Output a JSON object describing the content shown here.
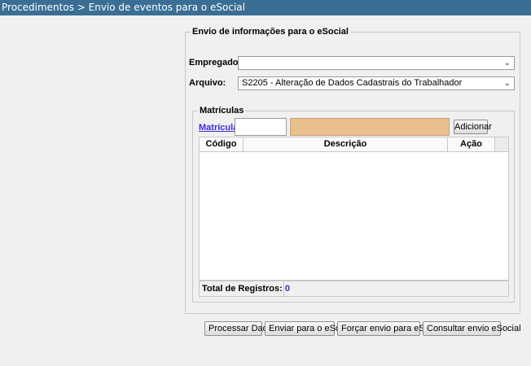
{
  "header": {
    "breadcrumb": "Procedimentos > Envio de eventos para o eSocial"
  },
  "form": {
    "legend": "Envio de informações para o eSocial",
    "empregador": {
      "label": "Empregador:",
      "value": ""
    },
    "arquivo": {
      "label": "Arquivo:",
      "value": "S2205 - Alteração de Dados Cadastrais do Trabalhador"
    }
  },
  "matriculas": {
    "legend": "Matrículas",
    "matricula_label": "Matrícula:",
    "matricula_value": "",
    "descricao_value": "",
    "add_button": "Adicionar",
    "columns": [
      "Código",
      "Descrição",
      "Ação"
    ],
    "rows": [],
    "total_label": "Total de Registros:",
    "total_count": "0"
  },
  "actions": {
    "processar": "Processar Dados",
    "enviar": "Enviar para o eSocial",
    "forcar": "Forçar envio para eSocial",
    "consultar": "Consultar envio eSocial"
  }
}
